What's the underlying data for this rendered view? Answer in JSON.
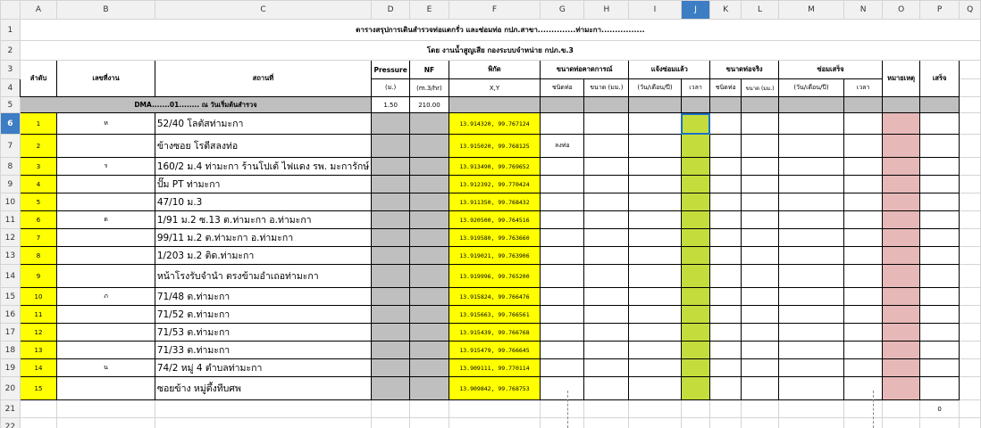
{
  "columns": [
    "A",
    "B",
    "C",
    "D",
    "E",
    "F",
    "G",
    "H",
    "I",
    "J",
    "K",
    "L",
    "M",
    "N",
    "O",
    "P",
    "Q"
  ],
  "selected_column": "J",
  "rows": [
    "1",
    "2",
    "3",
    "4",
    "5",
    "6",
    "7",
    "8",
    "9",
    "10",
    "11",
    "12",
    "13",
    "14",
    "15",
    "16",
    "17",
    "18",
    "19",
    "20",
    "21",
    "22"
  ],
  "selected_row": "6",
  "header": {
    "title1": "ตารางสรุปการเดินสำรวจท่อแตกรั่ว และซ่อมท่อ กปภ.สาขา..............ท่ามะกา................",
    "title2": "โดย งานน้ำสูญเสีย กองระบบจำหน่าย กปภ.ข.3",
    "col_no": "ลำดับ",
    "col_job": "เลขที่งาน",
    "col_location": "สถานที่",
    "col_pressure": "Pressure",
    "col_pressure_unit": "(ม.)",
    "col_nf": "NF",
    "col_nf_unit": "(m.3/hr)",
    "col_coord": "พิกัด",
    "col_coord_unit": "X,Y",
    "col_est_size": "ขนาดท่อคาดการณ์",
    "col_pipe_type": "ชนิดท่อ",
    "col_size_mm": "ขนาด (มม.)",
    "col_repair_notice": "แจ้งซ่อมแล้ว",
    "col_date": "(วัน/เดือน/ปี)",
    "col_time": "เวลา",
    "col_actual_size": "ขนาดท่อจริง",
    "col_pipe_type2": "ชนิดท่อ",
    "col_size2": "ขนาด (มม.)",
    "col_repaired": "ซ่อมเสร็จ",
    "col_date2": "(วัน/เดือน/ปี)",
    "col_time2": "เวลา",
    "col_remark": "หมายเหตุ",
    "col_done": "เสร็จ",
    "dma_label": "DMA.......01........ ณ วันเริ่มต้นสำรวจ",
    "pressure_value": "1.50",
    "nf_value": "210.00"
  },
  "entries": [
    {
      "no": "1",
      "job": "ห",
      "location": "52/40 โลตัสท่ามะกา",
      "coord": "13.914320, 99.767124",
      "pipe_type": ""
    },
    {
      "no": "2",
      "job": "",
      "location": "ข้างซอย โรตีสลงท่อ",
      "coord": "13.915020, 99.768125",
      "pipe_type": "ลงท่อ"
    },
    {
      "no": "3",
      "job": "ร",
      "location": "160/2 ม.4 ท่ามะกา ร้านโปเต้ ไฟแดง รพ. มะการักษ์",
      "coord": "13.913490, 99.769652",
      "pipe_type": ""
    },
    {
      "no": "4",
      "job": "",
      "location": "ปั๊ม PT ท่ามะกา",
      "coord": "13.912392, 99.770424",
      "pipe_type": ""
    },
    {
      "no": "5",
      "job": "",
      "location": "47/10 ม.3",
      "coord": "13.911350, 99.768432",
      "pipe_type": ""
    },
    {
      "no": "6",
      "job": "ต",
      "location": "1/91 ม.2 ซ.13 ต.ท่ามะกา อ.ท่ามะกา",
      "coord": "13.920500, 99.764516",
      "pipe_type": ""
    },
    {
      "no": "7",
      "job": "",
      "location": "99/11 ม.2 ต.ท่ามะกา อ.ท่ามะกา",
      "coord": "13.919580, 99.763660",
      "pipe_type": ""
    },
    {
      "no": "8",
      "job": "",
      "location": "1/203 ม.2 ติด.ท่ามะกา",
      "coord": "13.919021, 99.763906",
      "pipe_type": ""
    },
    {
      "no": "9",
      "job": "",
      "location": "หน้าโรงรับจำนำ ตรงข้ามอำเถอท่ามะกา",
      "coord": "13.919996, 99.765200",
      "pipe_type": ""
    },
    {
      "no": "10",
      "job": "ภ",
      "location": "71/48 ต.ท่ามะกา",
      "coord": "13.915824, 99.766476",
      "pipe_type": ""
    },
    {
      "no": "11",
      "job": "",
      "location": "71/52 ต.ท่ามะกา",
      "coord": "13.915663, 99.766561",
      "pipe_type": ""
    },
    {
      "no": "12",
      "job": "",
      "location": "71/53  ต.ท่ามะกา",
      "coord": "13.915439, 99.766768",
      "pipe_type": ""
    },
    {
      "no": "13",
      "job": "",
      "location": "71/33 ต.ท่ามะกา",
      "coord": "13.915479, 99.766645",
      "pipe_type": ""
    },
    {
      "no": "14",
      "job": "น",
      "location": "74/2 หมู่ 4 ตำบลท่ามะกา",
      "coord": "13.909111, 99.770114",
      "pipe_type": ""
    },
    {
      "no": "15",
      "job": "",
      "location": "ซอยข้าง หมู่ตึ้งทีบศพ",
      "coord": "13.909842, 99.768753",
      "pipe_type": ""
    }
  ],
  "row21_p": "0"
}
